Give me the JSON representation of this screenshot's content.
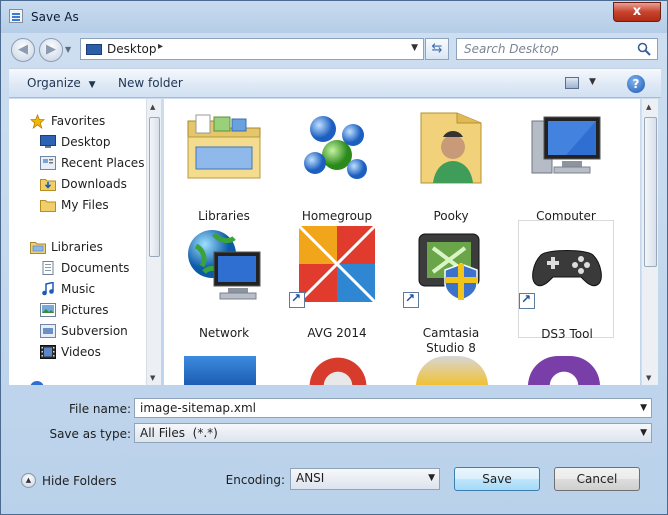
{
  "window": {
    "title": "Save As",
    "close_label": "x"
  },
  "address": {
    "location": "Desktop"
  },
  "search": {
    "placeholder": "Search Desktop"
  },
  "toolbar": {
    "organize_label": "Organize",
    "new_folder_label": "New folder",
    "help_label": "?"
  },
  "nav": {
    "items": [
      {
        "label": "Favorites",
        "icon": "star-icon",
        "indent": 0
      },
      {
        "label": "Desktop",
        "icon": "desktop-icon",
        "indent": 1
      },
      {
        "label": "Recent Places",
        "icon": "recent-places-icon",
        "indent": 1
      },
      {
        "label": "Downloads",
        "icon": "downloads-folder-icon",
        "indent": 1
      },
      {
        "label": "My Files",
        "icon": "folder-icon",
        "indent": 1
      },
      {
        "label": "Libraries",
        "icon": "libraries-icon",
        "indent": 0
      },
      {
        "label": "Documents",
        "icon": "documents-icon",
        "indent": 1
      },
      {
        "label": "Music",
        "icon": "music-icon",
        "indent": 1
      },
      {
        "label": "Pictures",
        "icon": "pictures-icon",
        "indent": 1
      },
      {
        "label": "Subversion",
        "icon": "subversion-icon",
        "indent": 1
      },
      {
        "label": "Videos",
        "icon": "videos-icon",
        "indent": 1
      }
    ]
  },
  "files": {
    "items": [
      {
        "name": "Libraries",
        "icon": "libraries-icon",
        "shortcut": false
      },
      {
        "name": "Homegroup",
        "icon": "homegroup-icon",
        "shortcut": false
      },
      {
        "name": "Pooky",
        "icon": "user-folder-icon",
        "shortcut": false
      },
      {
        "name": "Computer",
        "icon": "computer-icon",
        "shortcut": false
      },
      {
        "name": "Network",
        "icon": "network-icon",
        "shortcut": false
      },
      {
        "name": "AVG 2014",
        "icon": "avg-icon",
        "shortcut": true
      },
      {
        "name": "Camtasia Studio 8",
        "icon": "camtasia-icon",
        "shortcut": true
      },
      {
        "name": "DS3 Tool",
        "icon": "gamepad-icon",
        "shortcut": true
      }
    ]
  },
  "form": {
    "file_name_label": "File name:",
    "file_name_value": "image-sitemap.xml",
    "save_type_label": "Save as type:",
    "save_type_value": "All Files  (*.*)",
    "encoding_label": "Encoding:",
    "encoding_value": "ANSI",
    "hide_folders_label": "Hide Folders",
    "save_label": "Save",
    "cancel_label": "Cancel"
  }
}
